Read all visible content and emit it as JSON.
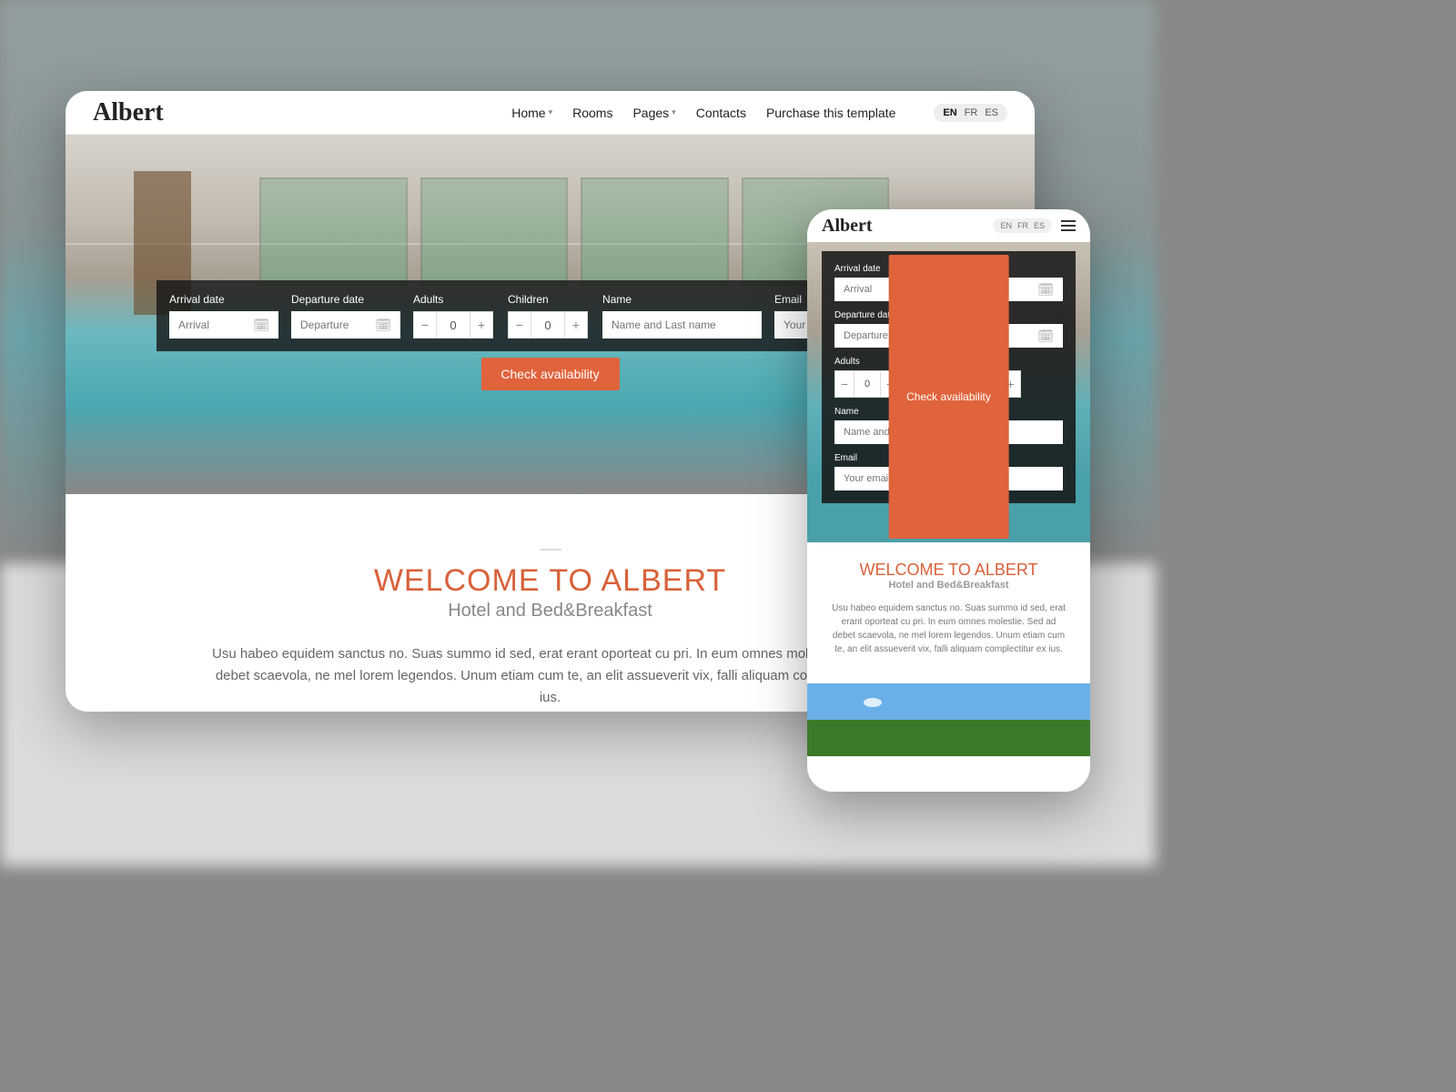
{
  "brand": "Albert",
  "nav": {
    "items": [
      "Home",
      "Rooms",
      "Pages",
      "Contacts",
      "Purchase this template"
    ],
    "has_dropdown": [
      true,
      false,
      true,
      false,
      false
    ]
  },
  "languages": [
    "EN",
    "FR",
    "ES"
  ],
  "booking": {
    "arrival_label": "Arrival date",
    "arrival_placeholder": "Arrival",
    "departure_label": "Departure date",
    "departure_placeholder": "Departure",
    "adults_label": "Adults",
    "adults_value": "0",
    "children_label": "Children",
    "children_value": "0",
    "name_label": "Name",
    "name_placeholder": "Name and Last name",
    "email_label": "Email",
    "email_placeholder": "Your email",
    "cta": "Check availability"
  },
  "welcome": {
    "title": "WELCOME TO ALBERT",
    "subtitle": "Hotel and Bed&Breakfast",
    "body_desktop": "Usu habeo equidem sanctus no. Suas summo id sed, erat erant oporteat cu pri. In eum omnes molestie. Sed ad debet scaevola, ne mel lorem legendos. Unum etiam cum te, an elit assueverit vix, falli aliquam complectitur ex ius.",
    "body_mobile": "Usu habeo equidem sanctus no. Suas summo id sed, erat erant oporteat cu pri. In eum omnes molestie. Sed ad debet scaevola, ne mel lorem legendos. Unum etiam cum te, an elit assueverit vix, falli aliquam complectitur ex ius."
  },
  "colors": {
    "accent": "#e0633c",
    "heading": "#d8613a"
  }
}
